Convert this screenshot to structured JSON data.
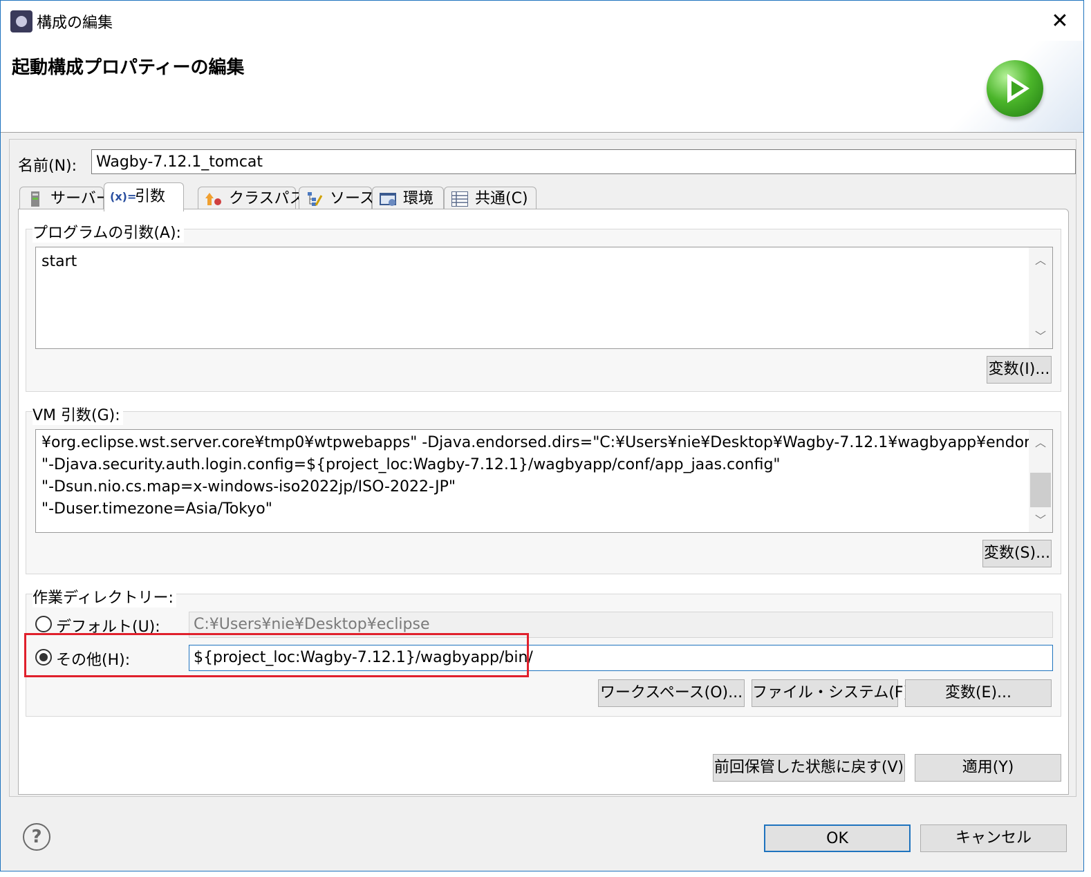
{
  "window": {
    "title": "構成の編集"
  },
  "header": {
    "title": "起動構成プロパティーの編集"
  },
  "name": {
    "label": "名前(N):",
    "value": "Wagby-7.12.1_tomcat"
  },
  "tabs": [
    {
      "label": "サーバー",
      "icon": "server-icon"
    },
    {
      "label": "引数",
      "icon": "variable-icon"
    },
    {
      "label": "クラスパス",
      "icon": "classpath-icon"
    },
    {
      "label": "ソース",
      "icon": "source-icon"
    },
    {
      "label": "環境",
      "icon": "environment-icon"
    },
    {
      "label": "共通(C)",
      "icon": "common-icon"
    }
  ],
  "program_args": {
    "label": "プログラムの引数(A):",
    "value": "start",
    "variables_button": "変数(I)..."
  },
  "vm_args": {
    "label": "VM 引数(G):",
    "lines": [
      "¥org.eclipse.wst.server.core¥tmp0¥wtpwebapps\" -Djava.endorsed.dirs=\"C:¥Users¥nie¥Desktop¥Wagby-7.12.1¥wagbyapp¥endorsed\"",
      "\"-Djava.security.auth.login.config=${project_loc:Wagby-7.12.1}/wagbyapp/conf/app_jaas.config\"",
      "\"-Dsun.nio.cs.map=x-windows-iso2022jp/ISO-2022-JP\"",
      "\"-Duser.timezone=Asia/Tokyo\""
    ],
    "variables_button": "変数(S)..."
  },
  "working_dir": {
    "label": "作業ディレクトリー:",
    "default_label": "デフォルト(U):",
    "default_value": "C:¥Users¥nie¥Desktop¥eclipse",
    "other_label": "その他(H):",
    "other_value": "${project_loc:Wagby-7.12.1}/wagbyapp/bin/",
    "workspace_button": "ワークスペース(O)...",
    "filesystem_button": "ファイル・システム(F)...",
    "variables_button": "変数(E)..."
  },
  "footer": {
    "revert_button": "前回保管した状態に戻す(V)",
    "apply_button": "適用(Y)",
    "ok_button": "OK",
    "cancel_button": "キャンセル"
  }
}
